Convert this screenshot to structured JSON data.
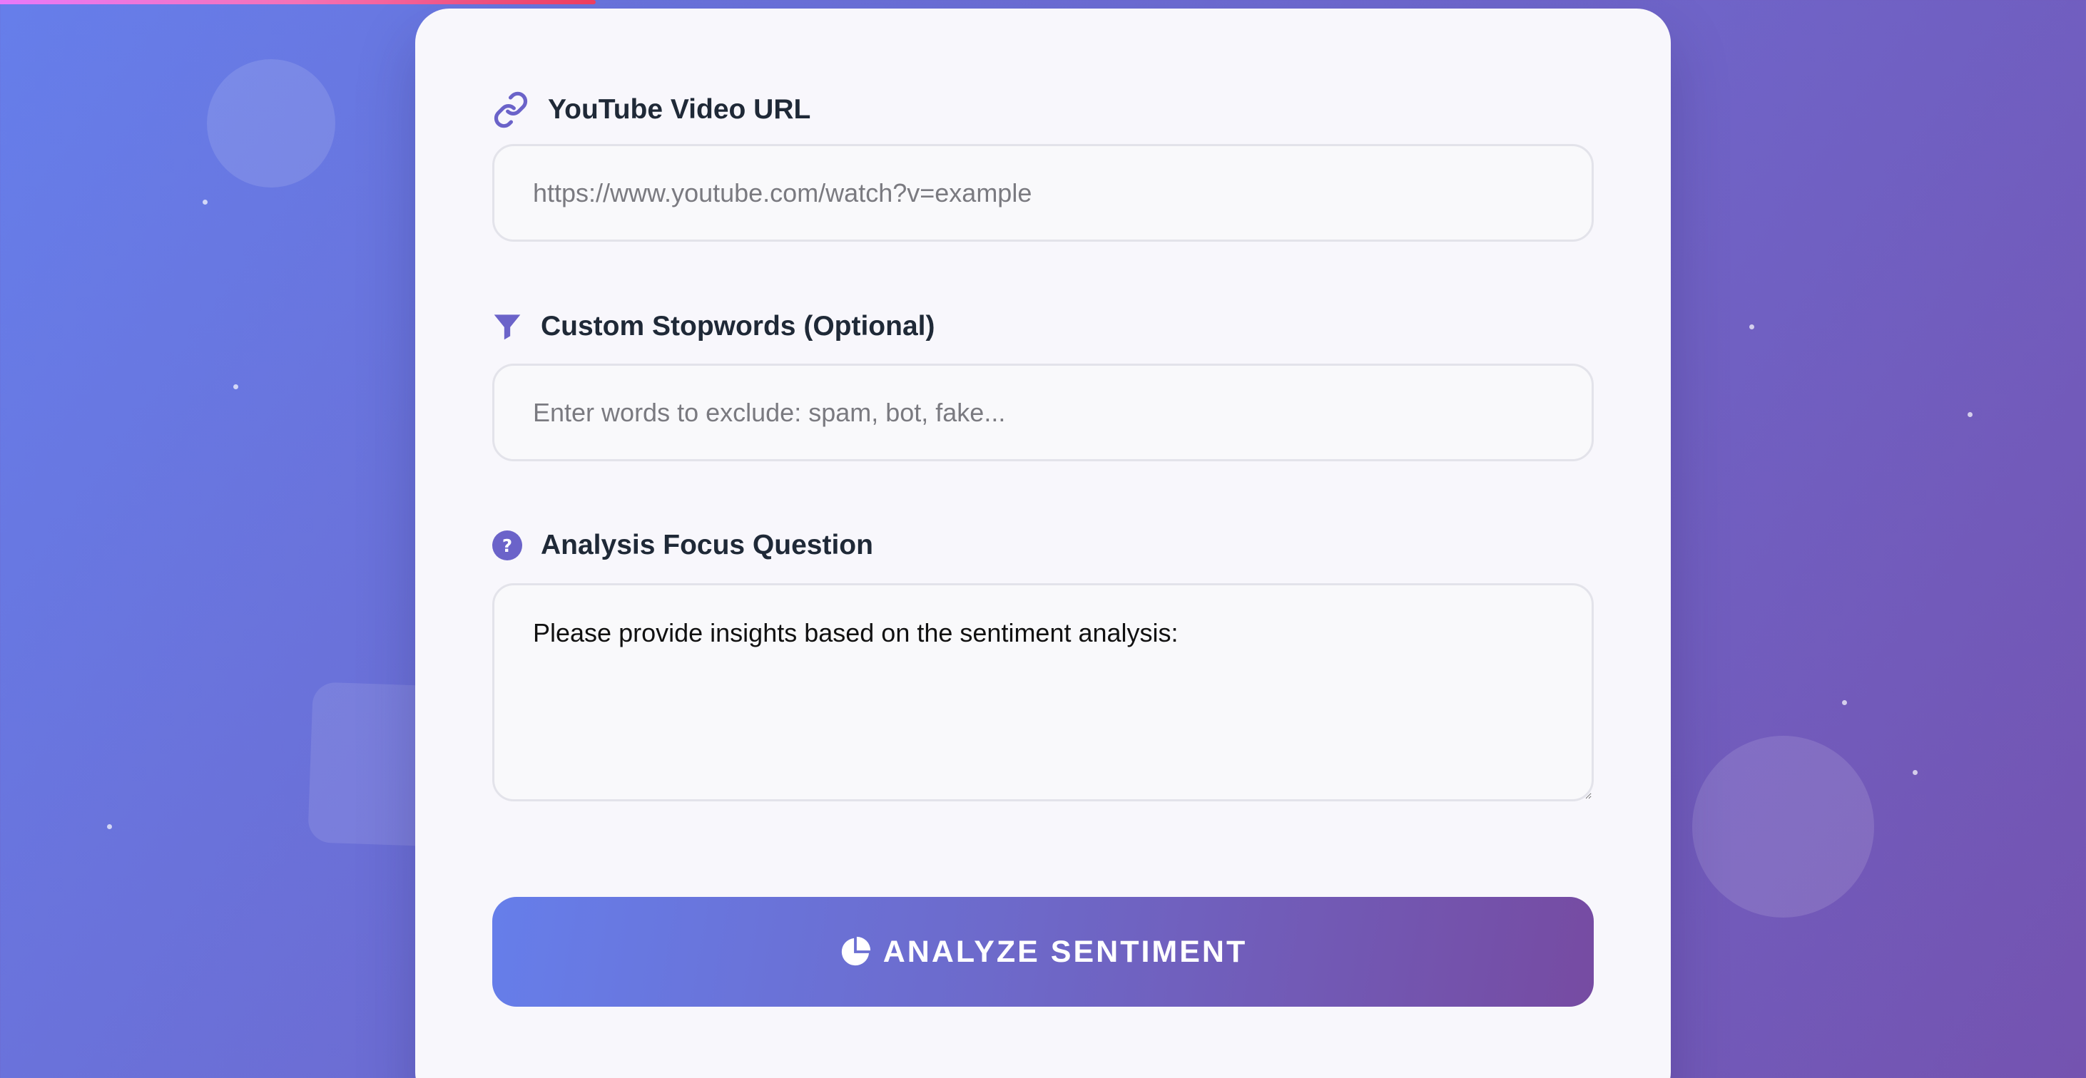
{
  "form": {
    "url_field": {
      "label": "YouTube Video URL",
      "icon": "link-icon",
      "placeholder": "https://www.youtube.com/watch?v=example",
      "value": ""
    },
    "stopwords_field": {
      "label": "Custom Stopwords (Optional)",
      "icon": "filter-icon",
      "placeholder": "Enter words to exclude: spam, bot, fake...",
      "value": ""
    },
    "question_field": {
      "label": "Analysis Focus Question",
      "icon": "question-circle-icon",
      "value": "Please provide insights based on the sentiment analysis:"
    },
    "submit": {
      "label": "ANALYZE SENTIMENT",
      "icon": "pie-chart-icon"
    }
  },
  "colors": {
    "accent": "#667eea",
    "accent_end": "#764ba2",
    "icon": "#6b63c9",
    "label_text": "#1f2937"
  }
}
